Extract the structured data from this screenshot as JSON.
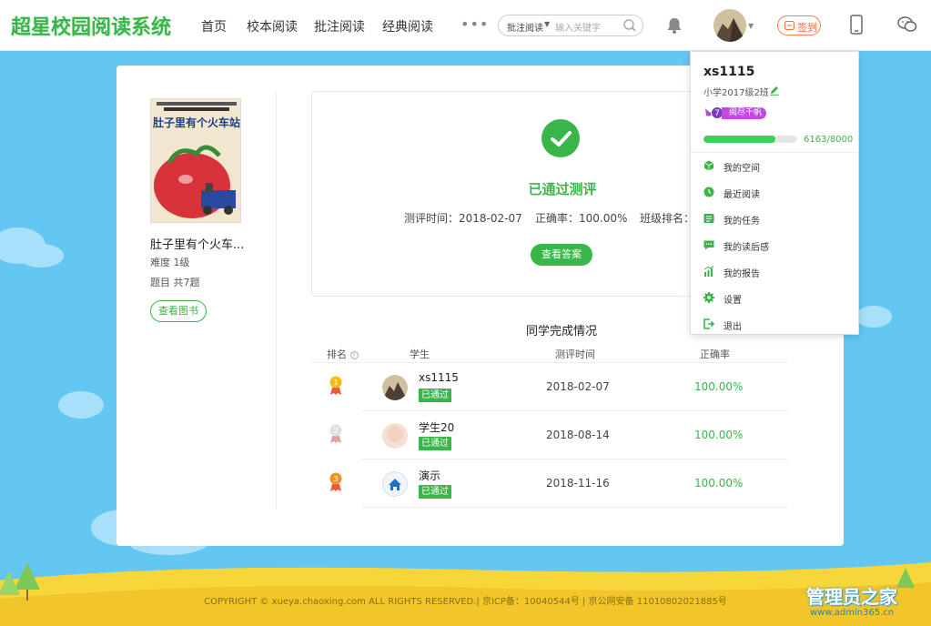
{
  "app": {
    "logo": "超星校园阅读系统"
  },
  "nav": [
    {
      "label": "首页"
    },
    {
      "label": "校本阅读"
    },
    {
      "label": "批注阅读"
    },
    {
      "label": "经典阅读"
    }
  ],
  "nav_more": "•••",
  "search": {
    "type": "批注阅读",
    "placeholder": "输入关键字"
  },
  "signin_label": "签到",
  "book": {
    "title": "肚子里有个火车...",
    "cover_title": "肚子里有个火车站",
    "difficulty": "难度 1级",
    "questions": "题目 共7题",
    "view_label": "查看图书"
  },
  "result": {
    "status": "已通过测评",
    "test_time": "测评时间：2018-02-07",
    "accuracy": "正确率：100.00%",
    "rank": "班级排名：",
    "answer_button": "查看答案"
  },
  "classmates": {
    "title": "同学完成情况",
    "headers": {
      "rank": "排名",
      "student": "学生",
      "time": "测评时间",
      "accuracy": "正确率"
    },
    "rows": [
      {
        "rank": "1",
        "name": "xs1115",
        "status": "已通过",
        "date": "2018-02-07",
        "accuracy": "100.00%"
      },
      {
        "rank": "2",
        "name": "学生20",
        "status": "已通过",
        "date": "2018-08-14",
        "accuracy": "100.00%"
      },
      {
        "rank": "3",
        "name": "演示",
        "status": "已通过",
        "date": "2018-11-16",
        "accuracy": "100.00%"
      }
    ]
  },
  "user_menu": {
    "username": "xs1115",
    "class": "小学2017级2班",
    "level_num": "7",
    "level_name": "阅尽千帆",
    "progress_fraction": 0.7704,
    "score": "6163/8000",
    "items": [
      {
        "label": "我的空间",
        "icon": "cube-icon"
      },
      {
        "label": "最近阅读",
        "icon": "clock-icon"
      },
      {
        "label": "我的任务",
        "icon": "task-list-icon"
      },
      {
        "label": "我的读后感",
        "icon": "comment-icon"
      },
      {
        "label": "我的报告",
        "icon": "chart-icon"
      },
      {
        "label": "设置",
        "icon": "gear-icon"
      },
      {
        "label": "退出",
        "icon": "logout-icon"
      }
    ]
  },
  "footer": "COPYRIGHT © xueya.chaoxing.com ALL RIGHTS RESERVED.| 京ICP备：10040544号 | 京公网安备 11010802021885号",
  "watermark": {
    "title": "管理员之家",
    "url": "www.admin365.cn"
  },
  "colors": {
    "accent": "#3ab54a",
    "sky": "#63c7f2",
    "signin": "#ff6a3c",
    "level": "#c04ae0"
  }
}
